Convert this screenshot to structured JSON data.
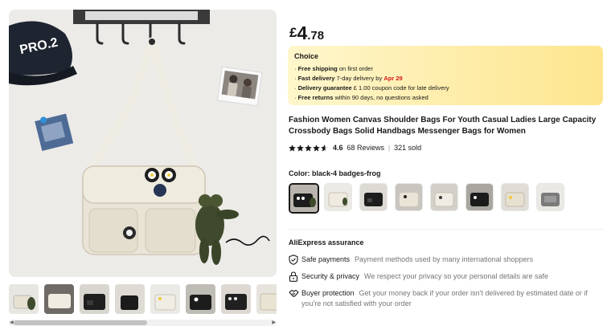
{
  "product": {
    "price": {
      "currency": "£",
      "integer": "4",
      "decimal": ".78"
    },
    "choice": {
      "title": "Choice",
      "items": [
        {
          "bold": "Free shipping",
          "text": " on first order"
        },
        {
          "bold": "Fast delivery",
          "text": " 7-day delivery by ",
          "highlight": "Apr 29"
        },
        {
          "bold": "Delivery guarantee",
          "text": "  £ 1.00 coupon code for late delivery"
        },
        {
          "bold": "Free returns",
          "text": "  within 90 days, no questions asked"
        }
      ]
    },
    "title": "Fashion Women Canvas Shoulder Bags For Youth Casual Ladies Large Capacity Crossbody Bags Solid Handbags Messenger Bags for Women",
    "rating": {
      "value": "4.6",
      "stars": 4.6,
      "reviews": "68 Reviews",
      "sold": "321 sold"
    },
    "color": {
      "label": "Color: black-4 badges-frog",
      "selected_index": 0,
      "swatch_count": 8
    },
    "assurance": {
      "title": "AliExpress assurance",
      "items": [
        {
          "icon": "shield-check-icon",
          "label": "Safe payments",
          "text": "Payment methods used by many international shoppers"
        },
        {
          "icon": "lock-icon",
          "label": "Security & privacy",
          "text": "We respect your privacy so your personal details are safe"
        },
        {
          "icon": "handshake-icon",
          "label": "Buyer protection",
          "text": "Get your money back if your order isn't delivered by estimated date or if you're not satisfied with your order"
        }
      ]
    }
  },
  "gallery": {
    "main_cap_text": "PRO.2",
    "thumbnail_count": 8
  },
  "colors": {
    "accent_red": "#d31a1a",
    "choice_bg": "#fde68e",
    "text": "#191919",
    "muted": "#757575"
  }
}
